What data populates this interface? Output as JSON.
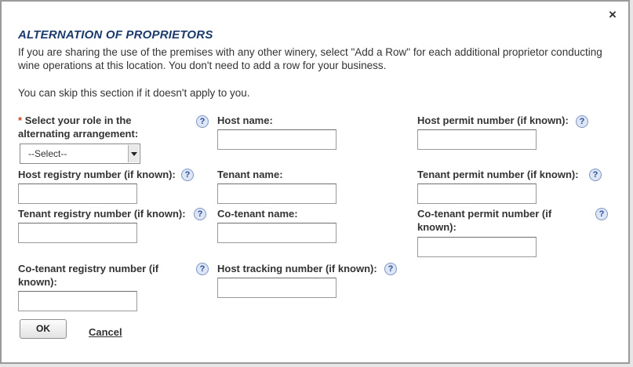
{
  "dialog": {
    "close_glyph": "×",
    "title": "ALTERNATION OF PROPRIETORS",
    "intro": "If you are sharing the use of the premises with any other winery, select \"Add a Row\" for each additional proprietor conducting wine operations at this location. You don't need to add a row for your business.",
    "skip_note": "You can skip this section if it doesn't apply to you."
  },
  "fields": {
    "role_label": "Select your role in the alternating arrangement:",
    "role_required_marker": "*",
    "role_value": "--Select--",
    "host_name": "Host name:",
    "host_permit": "Host permit number (if known):",
    "host_registry": "Host registry number (if known):",
    "tenant_name": "Tenant name:",
    "tenant_permit": "Tenant permit number (if known):",
    "tenant_registry": "Tenant registry number (if known):",
    "cotenant_name": "Co-tenant name:",
    "cotenant_permit": "Co-tenant permit number (if known):",
    "cotenant_registry": "Co-tenant registry number (if known):",
    "host_tracking": "Host tracking number (if known):"
  },
  "help_glyph": "?",
  "buttons": {
    "ok": "OK",
    "cancel": "Cancel"
  }
}
